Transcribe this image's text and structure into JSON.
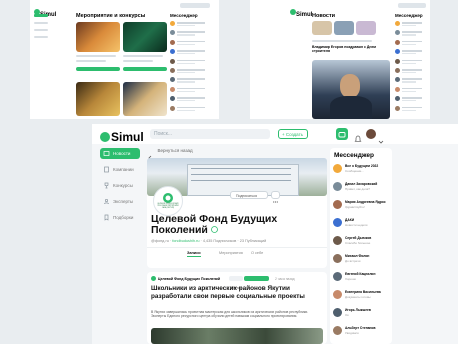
{
  "colors": {
    "accent": "#2dbd6e",
    "bg": "#e9edf0"
  },
  "brand": "Simul",
  "shot1": {
    "title": "Мероприятие и конкурсы",
    "panel_title": "Мессенджер"
  },
  "shot2": {
    "title": "Новости",
    "panel_title": "Мессенджер",
    "post_title": "Владимир Егоров поздравил с Днем строителя"
  },
  "header": {
    "search_placeholder": "Поиск...",
    "create_button": "+ Создать"
  },
  "sidebar": {
    "items": [
      {
        "label": "Новости",
        "icon": "newspaper-icon",
        "active": true
      },
      {
        "label": "Компании",
        "icon": "building-icon"
      },
      {
        "label": "Конкурсы",
        "icon": "trophy-icon"
      },
      {
        "label": "Эксперты",
        "icon": "user-icon"
      },
      {
        "label": "Подборки",
        "icon": "bookmark-icon"
      }
    ]
  },
  "main": {
    "back_link": "Вернуться назад",
    "logo_text": "ЦЕЛЕВОЙ ФОНД БУДУЩИХ ПОКОЛЕНИЙ РЕСПУБЛИКИ САХА (ЯКУТИЯ)",
    "org_name": "Целевой Фонд Будущих Поколений",
    "handle": "@фонд.ru",
    "site": "fondbudushih.ru",
    "subscribers": "4,435 Подписчиков",
    "publications": "23 Публикаций",
    "tabs": [
      "Записи",
      "Мероприятия",
      "О себе"
    ],
    "subscribe_btn": "Подписаться",
    "post_org": "Целевой Фонд Будущих Поколений",
    "post_tag1": "Якутск",
    "post_tag2": "Конференция",
    "post_date": "2 часа назад",
    "post_title": "Школьники из арктических районов Якутии разработали свои первые социальные проекты",
    "post_text": "В Якутии завершилась проектная мастерская для школьников из арктических районов республики. Эксперты Единого ресурсного центра обучили детей навыкам социального проектирования."
  },
  "messenger": {
    "title": "Мессенджер",
    "chats": [
      {
        "name": "Все о Будущем 2022",
        "msg": "Сообщение...",
        "color": "#f2a93b"
      },
      {
        "name": "Данил Захаровский",
        "msg": "Привет, как дела?",
        "color": "#7a8c99"
      },
      {
        "name": "Мария Андреевна Ядрос",
        "msg": "Здравствуйте!",
        "color": "#a36b4f"
      },
      {
        "name": "ДАКИ",
        "msg": "Новости недели",
        "color": "#3b6fd1"
      },
      {
        "name": "Сергей Дьячков",
        "msg": "Спасибо большое",
        "color": "#6d5a4a"
      },
      {
        "name": "Михаил Фолин",
        "msg": "До встречи",
        "color": "#8a6f5c"
      },
      {
        "name": "Евгений Кацнилин",
        "msg": "Хорошо",
        "color": "#5b6a78"
      },
      {
        "name": "Екатерина Васильева",
        "msg": "Документы готовы",
        "color": "#c78a6a"
      },
      {
        "name": "Игорь Лыкшеев",
        "msg": "Ок",
        "color": "#4f5f6e"
      },
      {
        "name": "Альберт Степанов",
        "msg": "Увидимся",
        "color": "#9a7b63"
      }
    ]
  }
}
